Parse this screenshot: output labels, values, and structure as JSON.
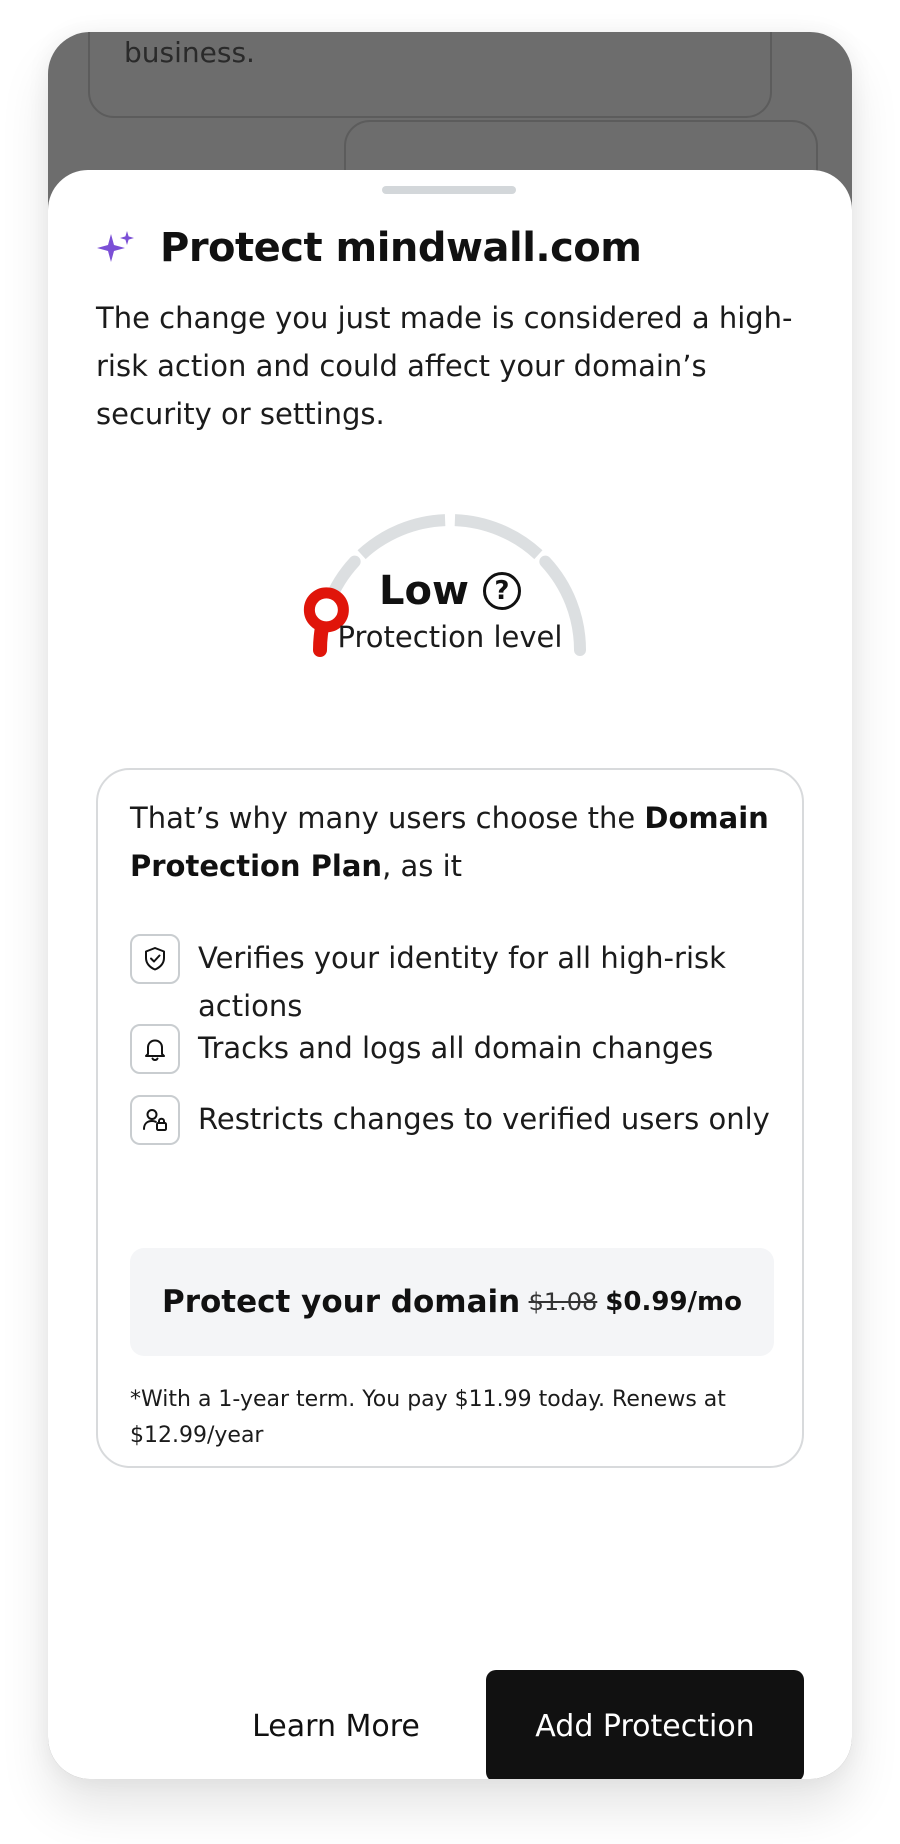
{
  "background": {
    "card_text": "business."
  },
  "sheet": {
    "title": "Protect mindwall.com",
    "description": "The change you just made is considered a high-risk action and could affect your domain’s security or settings.",
    "sparkle_icon": "sparkle-icon",
    "accent_color": "#7b4fd6"
  },
  "gauge": {
    "level": "Low",
    "caption": "Protection level",
    "level_fraction": 0.1,
    "segments": 4,
    "indicator_color": "#e0150a",
    "track_color": "#dcdfe1",
    "help_icon": "?"
  },
  "plan": {
    "intro_prefix": "That’s why many users choose the ",
    "intro_bold": "Domain Protection Plan",
    "intro_suffix": ", as it",
    "features": [
      {
        "icon": "shield-check-icon",
        "text": "Verifies your identity for all high-risk actions"
      },
      {
        "icon": "bell-icon",
        "text": "Tracks and logs all domain changes"
      },
      {
        "icon": "user-lock-icon",
        "text": "Restricts changes to verified users only"
      }
    ],
    "price_label": "Protect your domain",
    "price_old": "$1.08",
    "price_new": "$0.99/mo",
    "footnote": "*With a 1-year term. You pay $11.99 today. Renews at $12.99/year"
  },
  "actions": {
    "learn_more": "Learn More",
    "add_protection": "Add Protection"
  }
}
